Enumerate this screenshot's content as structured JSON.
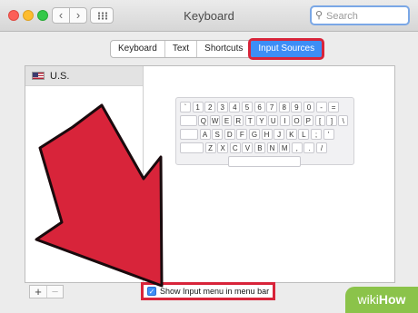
{
  "window": {
    "title": "Keyboard"
  },
  "search": {
    "placeholder": "Search"
  },
  "tabs": [
    {
      "label": "Keyboard"
    },
    {
      "label": "Text"
    },
    {
      "label": "Shortcuts"
    },
    {
      "label": "Input Sources",
      "selected": true
    }
  ],
  "sources": [
    {
      "label": "U.S.",
      "icon": "us-flag-icon"
    }
  ],
  "keyboard": {
    "rows": [
      [
        "`",
        "1",
        "2",
        "3",
        "4",
        "5",
        "6",
        "7",
        "8",
        "9",
        "0",
        "-",
        "="
      ],
      [
        "Q",
        "W",
        "E",
        "R",
        "T",
        "Y",
        "U",
        "I",
        "O",
        "P",
        "[",
        "]",
        "\\"
      ],
      [
        "A",
        "S",
        "D",
        "F",
        "G",
        "H",
        "J",
        "K",
        "L",
        ";",
        "'"
      ],
      [
        "Z",
        "X",
        "C",
        "V",
        "B",
        "N",
        "M",
        ",",
        ".",
        "/"
      ]
    ]
  },
  "controls": {
    "add": "+",
    "remove": "−"
  },
  "show_menu": {
    "label": "Show Input menu in menu bar",
    "checked": true
  },
  "watermark": {
    "prefix": "wiki",
    "suffix": "How"
  },
  "colors": {
    "accent": "#3d8ef6",
    "highlight": "#d8243a",
    "arrow": "#d8243a",
    "watermark": "#8bc34a"
  }
}
